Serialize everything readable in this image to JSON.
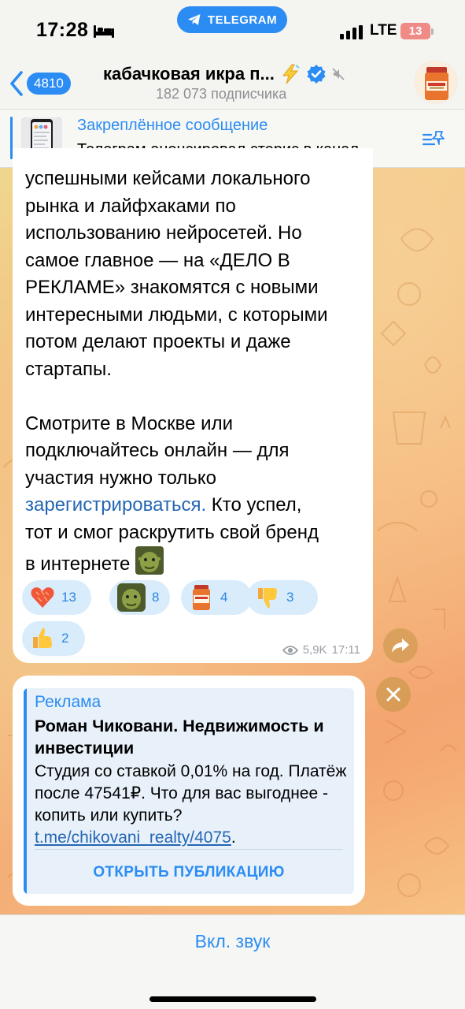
{
  "status_bar": {
    "time": "17:28",
    "app_pill": "TELEGRAM",
    "network": "LTE",
    "battery": "13"
  },
  "header": {
    "back_badge": "4810",
    "channel_title": "кабачковая икра п...",
    "subscribers": "182 073 подписчика"
  },
  "pinned": {
    "title": "Закреплённое сообщение",
    "text": "Телеграм анонсировал сторис в канал..."
  },
  "message": {
    "lines": [
      "успешными кейсами локального",
      "рынка и лайфхаками по",
      "использованию нейросетей. Но",
      "самое главное — на «ДЕЛО В",
      "РЕКЛАМЕ» знакомятся с новыми",
      "интересными людьми, с которыми",
      "потом делают проекты и даже",
      "стартапы.",
      "",
      "Смотрите в Москве или",
      "подключайтесь онлайн — для",
      "участия нужно только"
    ],
    "link_text": "зарегистрироваться.",
    "after_link": " Кто успел,",
    "line_tail_1": "тот и смог раскрутить свой бренд",
    "line_tail_2": "в интернете",
    "views": "5,9K",
    "time": "17:11",
    "reactions": [
      {
        "emoji": "heart",
        "count": "13"
      },
      {
        "emoji": "shrek",
        "count": "8"
      },
      {
        "emoji": "jar",
        "count": "4"
      },
      {
        "emoji": "thumbs-down",
        "count": "3"
      },
      {
        "emoji": "thumbs-up",
        "count": "2"
      }
    ]
  },
  "ad": {
    "label": "Реклама",
    "title": "Роман Чиковани. Недвижимость и инвестиции",
    "body": "Студия со ставкой 0,01% на год. Платёж после 47541₽. Что для вас выгоднее - копить или купить? ",
    "link": "t.me/chikovani_realty/4075",
    "link_end": ".",
    "button": "ОТКРЫТЬ ПУБЛИКАЦИЮ"
  },
  "bottom": {
    "sound_button": "Вкл. звук"
  },
  "colors": {
    "accent": "#2b8cf3",
    "link": "#2466b4",
    "reaction_bg": "#d9ecfc"
  }
}
